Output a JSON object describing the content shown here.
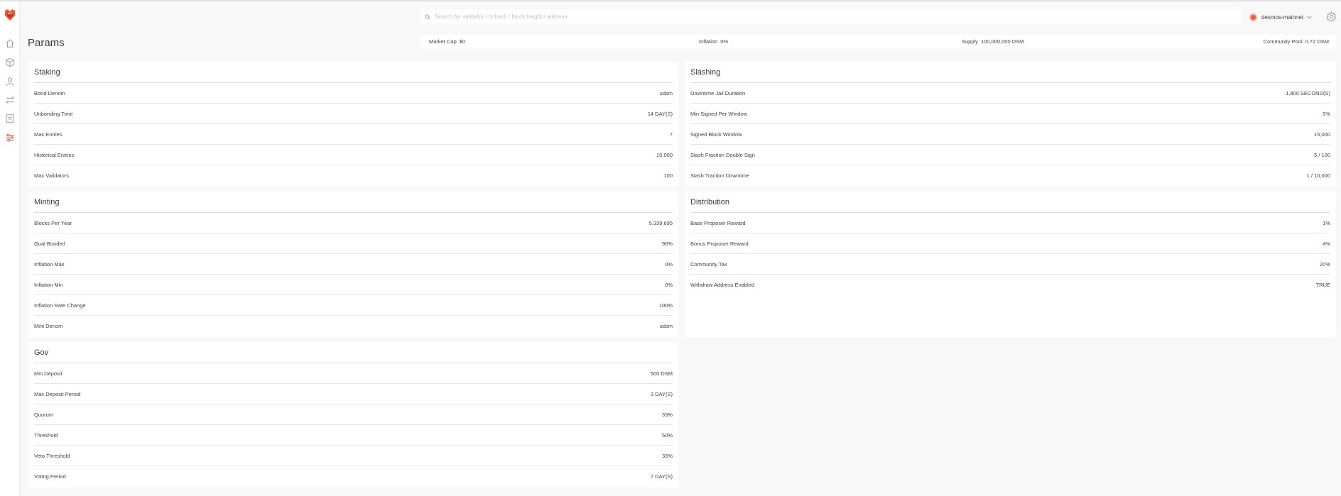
{
  "sidebar": {
    "items": [
      {
        "icon": "home-icon"
      },
      {
        "icon": "cube-icon"
      },
      {
        "icon": "user-icon"
      },
      {
        "icon": "transfer-icon"
      },
      {
        "icon": "document-icon"
      },
      {
        "icon": "sliders-icon",
        "active": true
      }
    ],
    "accent": "#ef5b39"
  },
  "header": {
    "search_placeholder": "Search for validator / tx hash / block height / address",
    "network": "desmos-mainnet"
  },
  "page": {
    "title": "Params"
  },
  "stats": {
    "market_cap_label": "Market Cap",
    "market_cap_value": "$0",
    "inflation_label": "Inflation",
    "inflation_value": "0%",
    "supply_label": "Supply",
    "supply_value": "100,000,000 DSM",
    "community_pool_label": "Community Pool",
    "community_pool_value": "0.72 DSM"
  },
  "staking": {
    "title": "Staking",
    "rows": [
      {
        "label": "Bond Denom",
        "value": "udsm"
      },
      {
        "label": "Unbonding Time",
        "value": "14 DAY(S)"
      },
      {
        "label": "Max Entries",
        "value": "7"
      },
      {
        "label": "Historical Entries",
        "value": "10,000"
      },
      {
        "label": "Max Validators",
        "value": "100"
      }
    ]
  },
  "slashing": {
    "title": "Slashing",
    "rows": [
      {
        "label": "Downtime Jail Duration",
        "value": "1,800 SECOND(S)"
      },
      {
        "label": "Min Signed Per Window",
        "value": "5%"
      },
      {
        "label": "Signed Block Window",
        "value": "15,000"
      },
      {
        "label": "Slash Fraction Double Sign",
        "value": "5 / 100"
      },
      {
        "label": "Slash Traction Downtime",
        "value": "1 / 10,000"
      }
    ]
  },
  "minting": {
    "title": "Minting",
    "rows": [
      {
        "label": "Blocks Per Year",
        "value": "5,339,695"
      },
      {
        "label": "Goal Bonded",
        "value": "90%"
      },
      {
        "label": "Inflation Max",
        "value": "0%"
      },
      {
        "label": "Inflation Min",
        "value": "0%"
      },
      {
        "label": "Inflation Rate Change",
        "value": "100%"
      },
      {
        "label": "Mint Denom",
        "value": "udsm"
      }
    ]
  },
  "distribution": {
    "title": "Distribution",
    "rows": [
      {
        "label": "Base Proposer Reward",
        "value": "1%"
      },
      {
        "label": "Bonus Proposer Reward",
        "value": "4%"
      },
      {
        "label": "Community Tax",
        "value": "20%"
      },
      {
        "label": "Withdraw Address Enabled",
        "value": "TRUE"
      }
    ]
  },
  "gov": {
    "title": "Gov",
    "rows": [
      {
        "label": "Min Deposit",
        "value": "500 DSM"
      },
      {
        "label": "Max Deposit Period",
        "value": "3 DAY(S)"
      },
      {
        "label": "Quorum",
        "value": "33%"
      },
      {
        "label": "Threshold",
        "value": "50%"
      },
      {
        "label": "Veto Threshold",
        "value": "33%"
      },
      {
        "label": "Voting Period",
        "value": "7 DAY(S)"
      }
    ]
  }
}
